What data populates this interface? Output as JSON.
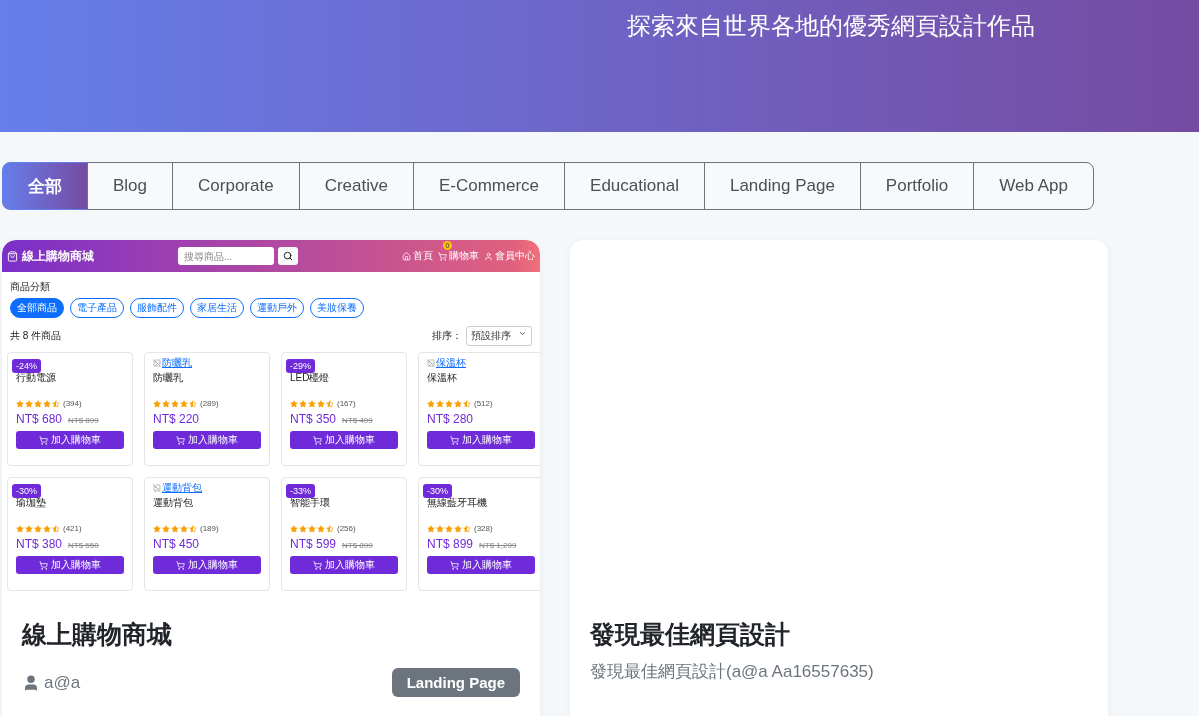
{
  "hero": {
    "subtitle": "探索來自世界各地的優秀網頁設計作品"
  },
  "filters": [
    {
      "label": "全部",
      "selected": true
    },
    {
      "label": "Blog",
      "selected": false
    },
    {
      "label": "Corporate",
      "selected": false
    },
    {
      "label": "Creative",
      "selected": false
    },
    {
      "label": "E-Commerce",
      "selected": false
    },
    {
      "label": "Educational",
      "selected": false
    },
    {
      "label": "Landing Page",
      "selected": false
    },
    {
      "label": "Portfolio",
      "selected": false
    },
    {
      "label": "Web App",
      "selected": false
    }
  ],
  "cards": [
    {
      "kind": "preview",
      "title": "線上購物商城",
      "author": "a@a",
      "category": "Landing Page",
      "preview": {
        "brand": "線上購物商城",
        "search_placeholder": "搜尋商品...",
        "nav": [
          {
            "label": "首頁"
          },
          {
            "label": "購物車",
            "count": "0"
          },
          {
            "label": "會員中心"
          }
        ],
        "category_heading": "商品分類",
        "categories": [
          {
            "label": "全部商品",
            "selected": true
          },
          {
            "label": "電子產品",
            "selected": false
          },
          {
            "label": "服飾配件",
            "selected": false
          },
          {
            "label": "家居生活",
            "selected": false
          },
          {
            "label": "運動戶外",
            "selected": false
          },
          {
            "label": "美妝保養",
            "selected": false
          }
        ],
        "count_text": "共 8 件商品",
        "sort_label": "排序：",
        "sort_value": "預設排序",
        "products": [
          {
            "name": "行動電源",
            "discount": "-24%",
            "stars": 4.5,
            "reviews": "(394)",
            "price": "NT$ 680",
            "old_price": "NT$ 899",
            "button": "加入購物車"
          },
          {
            "name": "防曬乳",
            "alt": "防曬乳",
            "stars": 4.5,
            "reviews": "(289)",
            "price": "NT$ 220",
            "button": "加入購物車"
          },
          {
            "name": "LED檯燈",
            "discount": "-29%",
            "stars": 4.5,
            "reviews": "(167)",
            "price": "NT$ 350",
            "old_price": "NT$ 499",
            "button": "加入購物車"
          },
          {
            "name": "保溫杯",
            "alt": "保溫杯",
            "stars": 4.5,
            "reviews": "(512)",
            "price": "NT$ 280",
            "button": "加入購物車"
          },
          {
            "name": "瑜珈墊",
            "discount": "-30%",
            "stars": 4.5,
            "reviews": "(421)",
            "price": "NT$ 380",
            "old_price": "NT$ 550",
            "button": "加入購物車"
          },
          {
            "name": "運動背包",
            "alt": "運動背包",
            "stars": 4.5,
            "reviews": "(189)",
            "price": "NT$ 450",
            "button": "加入購物車"
          },
          {
            "name": "智能手環",
            "discount": "-33%",
            "stars": 4.5,
            "reviews": "(256)",
            "price": "NT$ 599",
            "old_price": "NT$ 899",
            "button": "加入購物車"
          },
          {
            "name": "無線藍牙耳機",
            "discount": "-30%",
            "stars": 4.5,
            "reviews": "(328)",
            "price": "NT$ 899",
            "old_price": "NT$ 1,299",
            "button": "加入購物車"
          }
        ]
      }
    },
    {
      "kind": "blank",
      "title": "發現最佳網頁設計",
      "description": "發現最佳網頁設計(a@a Aa16557635)"
    }
  ]
}
